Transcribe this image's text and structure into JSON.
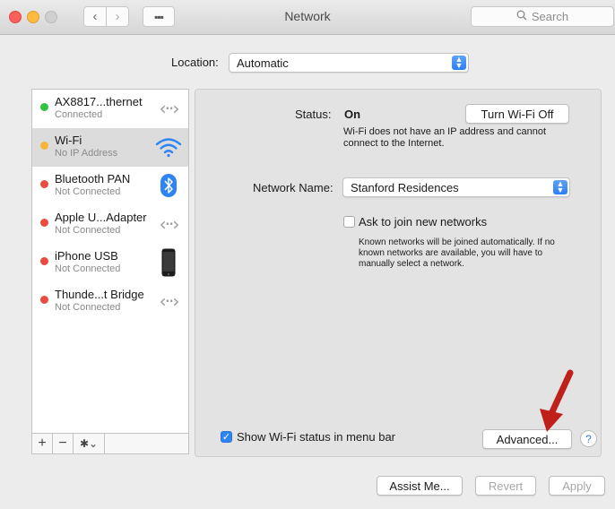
{
  "window": {
    "title": "Network",
    "search_placeholder": "Search",
    "nav": {
      "back": "‹",
      "forward": "›",
      "grid": "▪▪▪"
    }
  },
  "location": {
    "label": "Location:",
    "value": "Automatic"
  },
  "sidebar": {
    "services": [
      {
        "name": "AX8817...thernet",
        "status": "Connected",
        "dot": "green",
        "icon": "ethernet-icon"
      },
      {
        "name": "Wi-Fi",
        "status": "No IP Address",
        "dot": "yellow",
        "icon": "wifi-icon"
      },
      {
        "name": "Bluetooth PAN",
        "status": "Not Connected",
        "dot": "red",
        "icon": "bluetooth-icon"
      },
      {
        "name": "Apple U...Adapter",
        "status": "Not Connected",
        "dot": "red",
        "icon": "ethernet-icon"
      },
      {
        "name": "iPhone USB",
        "status": "Not Connected",
        "dot": "red",
        "icon": "iphone-icon"
      },
      {
        "name": "Thunde...t Bridge",
        "status": "Not Connected",
        "dot": "red",
        "icon": "ethernet-icon"
      }
    ],
    "toolbar": {
      "add": "+",
      "remove": "−",
      "action": "✱⌄"
    }
  },
  "detail": {
    "status_label": "Status:",
    "status_value": "On",
    "turn_off_button": "Turn Wi-Fi Off",
    "status_description": "Wi-Fi does not have an IP address and cannot connect to the Internet.",
    "network_name_label": "Network Name:",
    "network_name_value": "Stanford Residences",
    "ask_join_label": "Ask to join new networks",
    "ask_join_checked": false,
    "ask_join_description": "Known networks will be joined automatically. If no known networks are available, you will have to manually select a network.",
    "show_status_label": "Show Wi-Fi status in menu bar",
    "show_status_checked": true,
    "advanced_button": "Advanced...",
    "help_button": "?"
  },
  "footer": {
    "assist_button": "Assist Me...",
    "revert_button": "Revert",
    "apply_button": "Apply"
  },
  "colors": {
    "accent": "#2f84f4",
    "status_green": "#2dc440",
    "status_yellow": "#f5b43a",
    "status_red": "#eb4b3f",
    "annotation_arrow": "#c0201a"
  }
}
